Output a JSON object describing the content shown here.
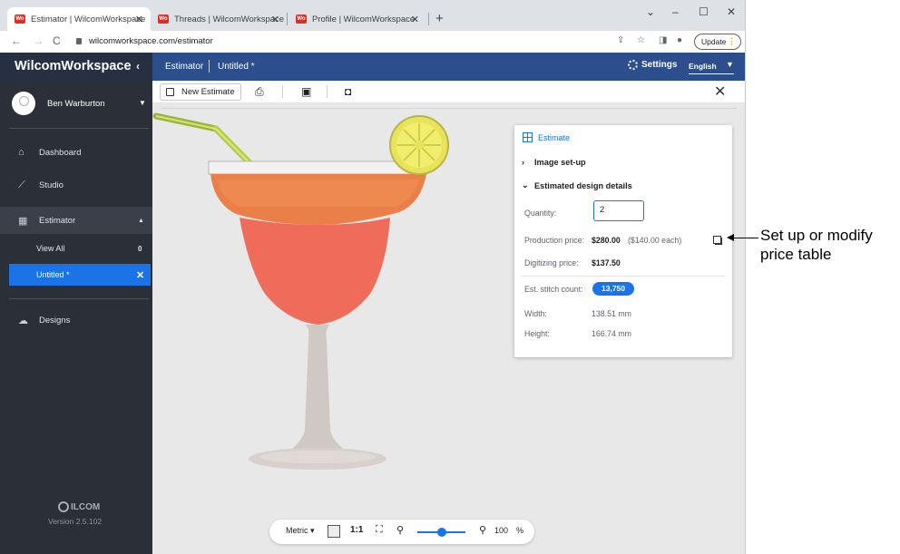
{
  "browser": {
    "tabs": [
      {
        "title": "Estimator | WilcomWorkspace",
        "favicon": "Wo"
      },
      {
        "title": "Threads | WilcomWorkspace",
        "favicon": "Wo"
      },
      {
        "title": "Profile | WilcomWorkspace",
        "favicon": "Wo"
      }
    ],
    "url": "wilcomworkspace.com/estimator",
    "update_label": "Update"
  },
  "app": {
    "brand": "WilcomWorkspace",
    "breadcrumb": [
      "Estimator",
      "Untitled *"
    ],
    "settings_label": "Settings",
    "language": "English"
  },
  "sidebar": {
    "user_name": "Ben Warburton",
    "items": [
      {
        "label": "Dashboard",
        "icon": "home-icon"
      },
      {
        "label": "Studio",
        "icon": "chart-icon"
      },
      {
        "label": "Estimator",
        "icon": "grid-icon"
      },
      {
        "label": "Designs",
        "icon": "cloud-icon"
      }
    ],
    "subitems": [
      {
        "label": "View All",
        "count": "0"
      },
      {
        "label": "Untitled *"
      }
    ],
    "logo": "ILCOM",
    "version": "Version 2.5.102"
  },
  "toolbar": {
    "new_estimate": "New Estimate",
    "icons": [
      "print-icon",
      "save-icon",
      "save-as-icon"
    ]
  },
  "estimate": {
    "title": "Estimate",
    "image_setup": "Image set-up",
    "details_title": "Estimated design details",
    "quantity_label": "Quantity:",
    "quantity_value": "2",
    "production_label": "Production price:",
    "production_value": "$280.00",
    "production_each": "($140.00 each)",
    "digitizing_label": "Digitizing price:",
    "digitizing_value": "$137.50",
    "stitch_label": "Est. stitch count:",
    "stitch_value": "13,750",
    "width_label": "Width:",
    "width_value": "138.51 mm",
    "height_label": "Height:",
    "height_value": "166.74 mm"
  },
  "zoombar": {
    "unit": "Metric",
    "one_to_one": "1:1",
    "zoom_percent": "100",
    "percent_sign": "%"
  },
  "callout": {
    "line1": "Set up or modify",
    "line2": "price table"
  },
  "colors": {
    "header_blue": "#2d4e8c",
    "sidebar_dark": "#2b2f38",
    "accent": "#1b73e8"
  }
}
